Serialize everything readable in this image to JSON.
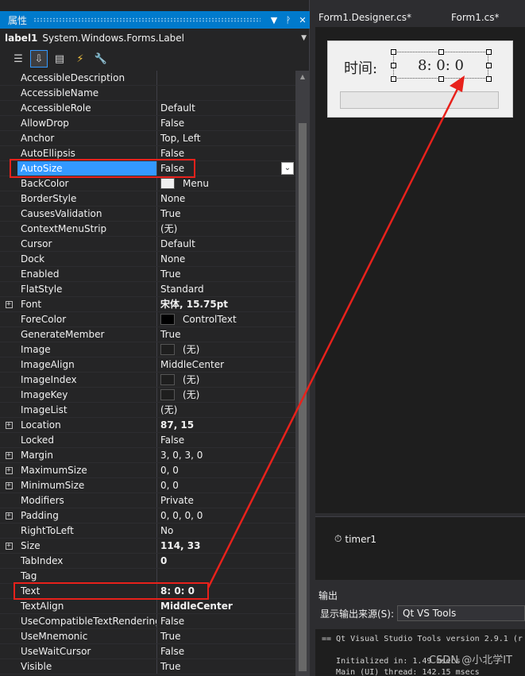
{
  "props_panel": {
    "title": "属性",
    "title_icons": [
      "▼",
      "ᚹ",
      "✕"
    ],
    "object_name": "label1",
    "object_type": "System.Windows.Forms.Label",
    "toolbar": [
      "categorized-icon",
      "alphabetical-icon",
      "properties-icon",
      "events-icon",
      "wrench-icon"
    ],
    "rows": [
      {
        "name": "AccessibleDescription",
        "value": ""
      },
      {
        "name": "AccessibleName",
        "value": ""
      },
      {
        "name": "AccessibleRole",
        "value": "Default"
      },
      {
        "name": "AllowDrop",
        "value": "False"
      },
      {
        "name": "Anchor",
        "value": "Top, Left"
      },
      {
        "name": "AutoEllipsis",
        "value": "False"
      },
      {
        "name": "AutoSize",
        "value": "False",
        "selected": true
      },
      {
        "name": "BackColor",
        "value": "Menu",
        "swatch": "#f0f0f0"
      },
      {
        "name": "BorderStyle",
        "value": "None"
      },
      {
        "name": "CausesValidation",
        "value": "True"
      },
      {
        "name": "ContextMenuStrip",
        "value": "(无)"
      },
      {
        "name": "Cursor",
        "value": "Default"
      },
      {
        "name": "Dock",
        "value": "None"
      },
      {
        "name": "Enabled",
        "value": "True"
      },
      {
        "name": "FlatStyle",
        "value": "Standard"
      },
      {
        "name": "Font",
        "value": "宋体, 15.75pt",
        "bold": true,
        "expand": true
      },
      {
        "name": "ForeColor",
        "value": "ControlText",
        "swatch": "#000000"
      },
      {
        "name": "GenerateMember",
        "value": "True"
      },
      {
        "name": "Image",
        "value": "(无)",
        "swatch": "#1e1e1e"
      },
      {
        "name": "ImageAlign",
        "value": "MiddleCenter"
      },
      {
        "name": "ImageIndex",
        "value": "(无)",
        "swatch": "#1e1e1e"
      },
      {
        "name": "ImageKey",
        "value": "(无)",
        "swatch": "#1e1e1e"
      },
      {
        "name": "ImageList",
        "value": "(无)"
      },
      {
        "name": "Location",
        "value": "87, 15",
        "bold": true,
        "expand": true
      },
      {
        "name": "Locked",
        "value": "False"
      },
      {
        "name": "Margin",
        "value": "3, 0, 3, 0",
        "expand": true
      },
      {
        "name": "MaximumSize",
        "value": "0, 0",
        "expand": true
      },
      {
        "name": "MinimumSize",
        "value": "0, 0",
        "expand": true
      },
      {
        "name": "Modifiers",
        "value": "Private"
      },
      {
        "name": "Padding",
        "value": "0, 0, 0, 0",
        "expand": true
      },
      {
        "name": "RightToLeft",
        "value": "No"
      },
      {
        "name": "Size",
        "value": "114, 33",
        "bold": true,
        "expand": true
      },
      {
        "name": "TabIndex",
        "value": "0",
        "bold": true
      },
      {
        "name": "Tag",
        "value": ""
      },
      {
        "name": "Text",
        "value": "8: 0: 0",
        "bold": true
      },
      {
        "name": "TextAlign",
        "value": "MiddleCenter",
        "bold": true
      },
      {
        "name": "UseCompatibleTextRendering",
        "value": "False"
      },
      {
        "name": "UseMnemonic",
        "value": "True"
      },
      {
        "name": "UseWaitCursor",
        "value": "False"
      },
      {
        "name": "Visible",
        "value": "True"
      }
    ]
  },
  "tabs": [
    "Form1.Designer.cs*",
    "Form1.cs*"
  ],
  "form": {
    "label_text": "时间:",
    "time_text": "8: 0: 0"
  },
  "tray": {
    "timer_label": "timer1"
  },
  "output": {
    "title": "输出",
    "source_label": "显示输出来源(S):",
    "source_value": "Qt VS Tools",
    "lines": [
      "== Qt Visual Studio Tools version 2.9.1 (r",
      "",
      "   Initialized in: 1.49 msecs",
      "   Main (UI) thread: 142.15 msecs"
    ]
  },
  "watermark": "CSDN @小北学IT",
  "colors": {
    "accent": "#007acc",
    "selection": "#3399ff",
    "annotation": "#e8211b"
  }
}
